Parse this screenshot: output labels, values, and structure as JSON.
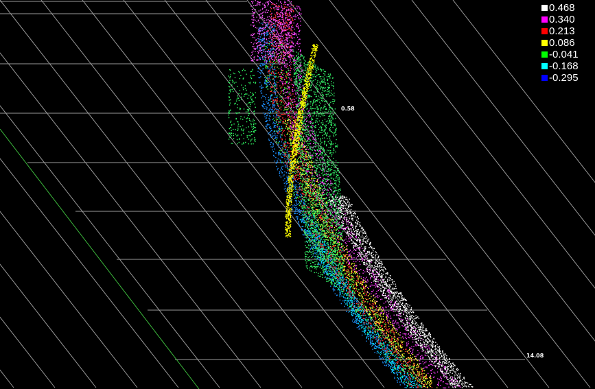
{
  "chart_data": {
    "type": "scatter",
    "projection": "3d-perspective",
    "grid": true,
    "legend_placement": "top-right",
    "axis_tick_labels": [
      "0.58",
      "14.08"
    ],
    "color_scale": [
      {
        "value": "0.468",
        "color": "#ffffff"
      },
      {
        "value": "0.340",
        "color": "#ff00ff"
      },
      {
        "value": "0.213",
        "color": "#ff0000"
      },
      {
        "value": "0.086",
        "color": "#ffff00"
      },
      {
        "value": "-0.041",
        "color": "#00ff00"
      },
      {
        "value": "-0.168",
        "color": "#00ffff"
      },
      {
        "value": "-0.295",
        "color": "#0000ff"
      }
    ]
  }
}
